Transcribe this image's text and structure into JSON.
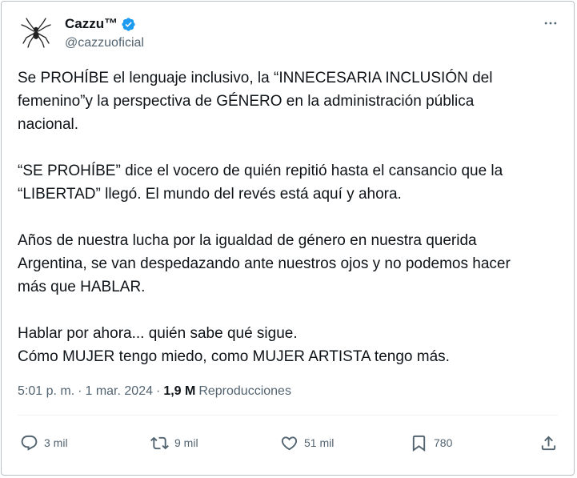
{
  "author": {
    "display_name": "Cazzu™",
    "handle": "@cazzuoficial",
    "verified": true
  },
  "tweet": {
    "paragraphs": [
      {
        "lines": [
          "Se PROHÍBE el lenguaje inclusivo, la “INNECESARIA INCLUSIÓN del",
          "femenino”y la perspectiva de GÉNERO en la administración pública",
          "nacional."
        ]
      },
      {
        "lines": [
          "“SE PROHÍBE” dice el vocero de quién repitió hasta el cansancio que la",
          "“LIBERTAD” llegó. El mundo del revés está aquí y ahora."
        ]
      },
      {
        "lines": [
          "Años de nuestra lucha por la igualdad de género en nuestra querida",
          "Argentina, se van despedazando ante nuestros ojos y no podemos hacer",
          "más que HABLAR."
        ]
      },
      {
        "lines": [
          "Hablar por ahora... quién sabe qué sigue.",
          "Cómo MUJER tengo miedo, como MUJER ARTISTA tengo más."
        ]
      }
    ]
  },
  "meta": {
    "time": "5:01 p. m.",
    "separator": "·",
    "date": "1 mar. 2024",
    "views_count": "1,9 M",
    "views_label": "Reproducciones"
  },
  "actions": {
    "replies": "3 mil",
    "retweets": "9 mil",
    "likes": "51 mil",
    "bookmarks": "780"
  },
  "icons": {
    "avatar": "spider-logo-icon",
    "verified": "verified-badge-icon",
    "more": "more-horizontal-icon",
    "reply": "reply-icon",
    "retweet": "retweet-icon",
    "like": "heart-icon",
    "bookmark": "bookmark-icon",
    "share": "share-icon"
  },
  "colors": {
    "text": "#0f1419",
    "secondary": "#536471",
    "verified": "#1d9bf0",
    "border": "#b9c0c6"
  }
}
